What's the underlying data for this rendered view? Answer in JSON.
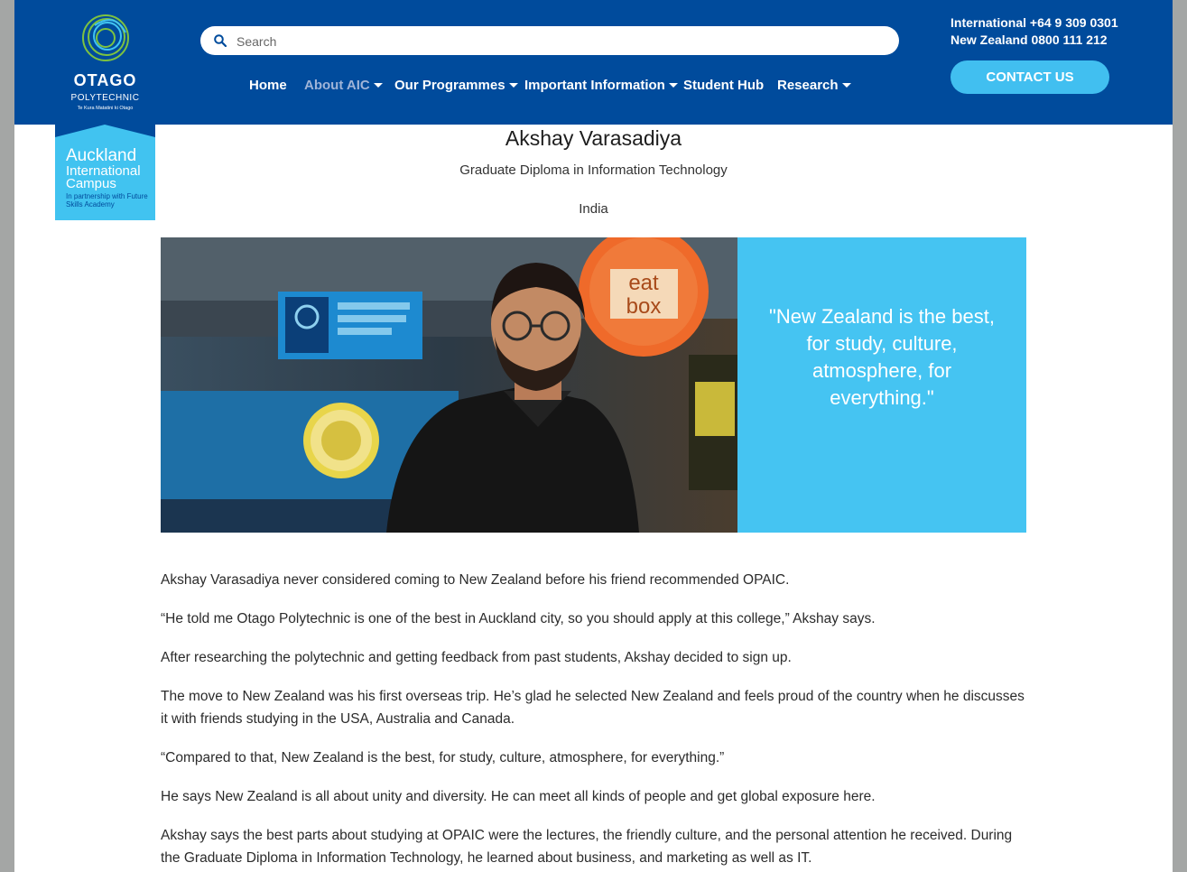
{
  "brand": {
    "name": "OTAGO",
    "sub": "POLYTECHNIC",
    "tagline": "Te Kura Matatini ki Otago",
    "campus_line1": "Auckland",
    "campus_line2": "International",
    "campus_line3": "Campus",
    "partner": "In partnership with Future Skills Academy"
  },
  "search": {
    "placeholder": "Search"
  },
  "nav": [
    {
      "label": "Home",
      "has_menu": false
    },
    {
      "label": "About AIC",
      "has_menu": true,
      "active": true
    },
    {
      "label": "Our Programmes",
      "has_menu": true
    },
    {
      "label": "Important Information",
      "has_menu": true
    },
    {
      "label": "Student Hub",
      "has_menu": false
    },
    {
      "label": "Research",
      "has_menu": true
    }
  ],
  "contact": {
    "international": "International +64 9 309 0301",
    "new_zealand": "New Zealand 0800 111 212",
    "button": "CONTACT US"
  },
  "profile": {
    "name": "Akshay Varasadiya",
    "programme": "Graduate Diploma in Information Technology",
    "country": "India",
    "quote": "\"New Zealand is the best, for study, culture, atmosphere, for everything.\"",
    "photo_signs": {
      "eatbox_line1": "eat",
      "eatbox_line2": "box"
    }
  },
  "article": [
    "Akshay Varasadiya never considered coming to New Zealand before his friend recommended OPAIC.",
    "“He told me Otago Polytechnic is one of the best in Auckland city, so you should apply at this college,” Akshay says.",
    "After researching the polytechnic and getting feedback from past students, Akshay decided to sign up.",
    "The move to New Zealand was his first overseas trip. He’s glad he selected New Zealand and feels proud of the country when he discusses it with friends studying in the USA, Australia and Canada.",
    "“Compared to that, New Zealand is the best, for study, culture, atmosphere, for everything.”",
    "He says New Zealand is all about unity and diversity. He can meet all kinds of people and get global exposure here.",
    "Akshay says the best parts about studying at OPAIC were the lectures, the friendly culture, and the personal attention he received. During the Graduate Diploma in Information Technology, he learned about business, and marketing as well as IT."
  ],
  "colors": {
    "header_blue": "#004b9c",
    "accent_cyan": "#41c3f0",
    "page_bg": "#a4a6a5"
  }
}
